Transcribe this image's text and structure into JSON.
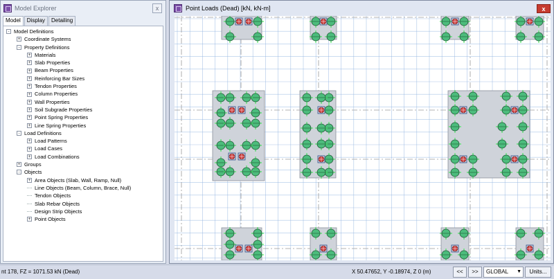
{
  "explorer": {
    "title": "Model Explorer",
    "close": "x",
    "tabs": [
      "Model",
      "Display",
      "Detailing"
    ],
    "tree": [
      {
        "level": 0,
        "box": "-",
        "label": "Model Definitions"
      },
      {
        "level": 1,
        "box": "+",
        "label": "Coordinate Systems"
      },
      {
        "level": 1,
        "box": "-",
        "label": "Property Definitions"
      },
      {
        "level": 2,
        "box": "+",
        "label": "Materials"
      },
      {
        "level": 2,
        "box": "+",
        "label": "Slab Properties"
      },
      {
        "level": 2,
        "box": "+",
        "label": "Beam Properties"
      },
      {
        "level": 2,
        "box": "+",
        "label": "Reinforcing Bar Sizes"
      },
      {
        "level": 2,
        "box": "+",
        "label": "Tendon Properties"
      },
      {
        "level": 2,
        "box": "+",
        "label": "Column Properties"
      },
      {
        "level": 2,
        "box": "+",
        "label": "Wall Properties"
      },
      {
        "level": 2,
        "box": "+",
        "label": "Soil Subgrade Properties"
      },
      {
        "level": 2,
        "box": "+",
        "label": "Point Spring Properties"
      },
      {
        "level": 2,
        "box": "+",
        "label": "Line Spring Properties"
      },
      {
        "level": 1,
        "box": "-",
        "label": "Load Definitions"
      },
      {
        "level": 2,
        "box": "+",
        "label": "Load Patterns"
      },
      {
        "level": 2,
        "box": "+",
        "label": "Load Cases"
      },
      {
        "level": 2,
        "box": "+",
        "label": "Load Combinations"
      },
      {
        "level": 1,
        "box": "+",
        "label": "Groups"
      },
      {
        "level": 1,
        "box": "-",
        "label": "Objects"
      },
      {
        "level": 2,
        "box": "+",
        "label": "Area Objects (Slab, Wall, Ramp, Null)"
      },
      {
        "level": 2,
        "box": "",
        "label": "Line Objects (Beam, Column, Brace, Null)"
      },
      {
        "level": 2,
        "box": "",
        "label": "Tendon Objects"
      },
      {
        "level": 2,
        "box": "",
        "label": "Slab Rebar Objects"
      },
      {
        "level": 2,
        "box": "",
        "label": "Design Strip Objects"
      },
      {
        "level": 2,
        "box": "+",
        "label": "Point Objects"
      }
    ]
  },
  "viewer": {
    "title": "Point Loads (Dead)  [kN,  kN-m]",
    "close": "x",
    "colors": {
      "grid": "#8fb2e0",
      "gridline": "#9a9a9a",
      "pile": "#4cbc7c",
      "column": "#cc3b3b",
      "cap": "#cfd3da",
      "load": "#2fe84a"
    }
  },
  "status": {
    "left_text": "nt 178,  FZ = 1071.53 kN  (Dead)",
    "coords": "X 50.47652,  Y -0.18974,  Z 0  (m)",
    "prev_label": "<<",
    "next_label": ">>",
    "coord_system": "GLOBAL",
    "units_label": "Units..."
  }
}
